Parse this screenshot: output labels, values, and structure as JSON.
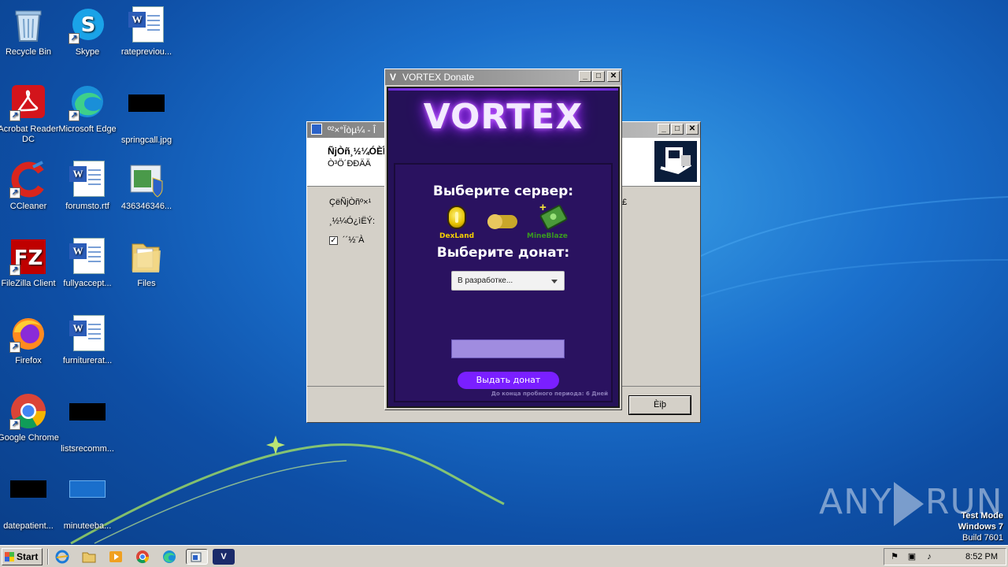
{
  "desktop": {
    "icons": [
      {
        "label": "Recycle Bin"
      },
      {
        "label": "Skype"
      },
      {
        "label": "ratepreviou..."
      },
      {
        "label": "Acrobat Reader DC"
      },
      {
        "label": "Microsoft Edge"
      },
      {
        "label": "springcall.jpg"
      },
      {
        "label": "CCleaner"
      },
      {
        "label": "forumsto.rtf"
      },
      {
        "label": "436346346..."
      },
      {
        "label": "FileZilla Client"
      },
      {
        "label": "fullyaccept..."
      },
      {
        "label": "Files"
      },
      {
        "label": "Firefox"
      },
      {
        "label": "furniturerat..."
      },
      {
        "label": "Google Chrome"
      },
      {
        "label": "listsrecomm..."
      },
      {
        "label": "datepatient..."
      },
      {
        "label": "minuteeba..."
      }
    ]
  },
  "installer_window": {
    "title": "º²×°Ïòµ¼ - Î",
    "header_line1": "ÑjÒñ¸½¼ÓÈÎ",
    "header_line2": "Ò³Ö´ÐÐÄÄ",
    "body_line1": "ÇëÑjÒñº×¹",
    "body_suffix": "£",
    "body_line2": "¸½¼Ó¿ìËÝ:",
    "checkbox_label": "´´½¨À",
    "checkbox_mark": "✓",
    "next_button": "Èiþ"
  },
  "vortex_window": {
    "title": "VORTEX Donate",
    "title_icon": "V",
    "logo": "VORTEX",
    "choose_server": "Выберите сервер:",
    "server_left": "DexLand",
    "server_right": "MineBlaze",
    "choose_donate": "Выберите донат:",
    "donate_select": "В разработке...",
    "submit_button": "Выдать донат",
    "trial_text": "До конца пробного периода: 6 Дней"
  },
  "watermark": {
    "left": "ANY",
    "right": "RUN"
  },
  "test_mode": {
    "line1": "Test Mode",
    "line2": "Windows 7",
    "line3": "Build 7601"
  },
  "taskbar": {
    "start_label": "Start",
    "clock": "8:52 PM"
  },
  "colors": {
    "vortex_bg": "#251158",
    "vortex_accent": "#7a1fff",
    "dexland_yellow": "#f5d000",
    "mineblaze_green": "#3a9a20"
  }
}
